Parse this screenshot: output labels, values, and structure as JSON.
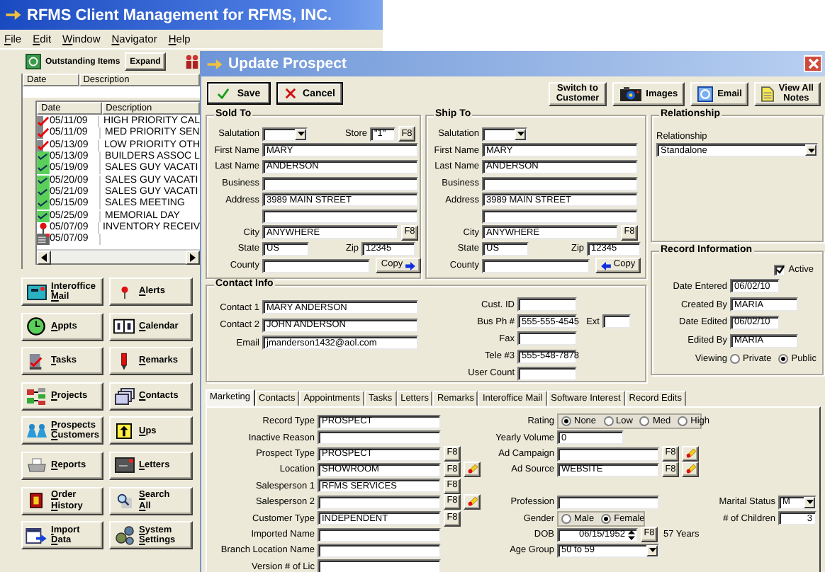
{
  "app": {
    "title": "RFMS Client Management for RFMS, INC.",
    "menu": [
      "File",
      "Edit",
      "Window",
      "Navigator",
      "Help"
    ],
    "toolbar": {
      "label": "Outstanding Items",
      "button": "Expand"
    },
    "outer_list": {
      "columns": [
        "Date",
        "Description"
      ]
    },
    "items": {
      "columns": [
        "Date",
        "Description"
      ],
      "rows": [
        {
          "kind": "task",
          "date": "05/11/09",
          "description": "HIGH PRIORITY CAL"
        },
        {
          "kind": "task",
          "date": "05/11/09",
          "description": "MED PRIORITY SEN"
        },
        {
          "kind": "task",
          "date": "05/13/09",
          "description": "LOW PRIORITY OTH"
        },
        {
          "kind": "appointment",
          "date": "05/13/09",
          "description": "BUILDERS ASSOC L"
        },
        {
          "kind": "appointment",
          "date": "05/19/09",
          "description": "SALES GUY VACATI"
        },
        {
          "kind": "appointment",
          "date": "05/20/09",
          "description": "SALES GUY VACATI"
        },
        {
          "kind": "appointment",
          "date": "05/21/09",
          "description": "SALES GUY VACATI"
        },
        {
          "kind": "appointment",
          "date": "05/15/09",
          "description": "SALES MEETING"
        },
        {
          "kind": "appointment",
          "date": "05/25/09",
          "description": "MEMORIAL DAY"
        },
        {
          "kind": "alert",
          "date": "05/07/09",
          "description": "INVENTORY RECEIV"
        },
        {
          "kind": "memo",
          "date": "05/07/09"
        }
      ]
    },
    "nav_buttons": [
      {
        "kind": "mail",
        "lines": [
          "Interoffice",
          "Mail"
        ]
      },
      {
        "kind": "alert",
        "lines": [
          "Alerts"
        ]
      },
      {
        "kind": "clock",
        "lines": [
          "Appts"
        ]
      },
      {
        "kind": "calendar",
        "lines": [
          "Calendar"
        ]
      },
      {
        "kind": "tasks",
        "lines": [
          "Tasks"
        ]
      },
      {
        "kind": "remarks",
        "lines": [
          "Remarks"
        ]
      },
      {
        "kind": "projects",
        "lines": [
          "Projects"
        ]
      },
      {
        "kind": "contacts",
        "lines": [
          "Contacts"
        ]
      },
      {
        "kind": "people",
        "lines": [
          "Prospects",
          "Customers"
        ]
      },
      {
        "kind": "ups",
        "lines": [
          "Ups"
        ]
      },
      {
        "kind": "reports",
        "lines": [
          "Reports"
        ]
      },
      {
        "kind": "letters",
        "lines": [
          "Letters"
        ]
      },
      {
        "kind": "order",
        "lines": [
          "Order",
          "History"
        ]
      },
      {
        "kind": "search",
        "lines": [
          "Search",
          "All"
        ]
      },
      {
        "kind": "import",
        "lines": [
          "Import",
          "Data"
        ]
      },
      {
        "kind": "settings",
        "lines": [
          "System",
          "Settings"
        ]
      }
    ]
  },
  "dialog": {
    "title": "Update Prospect",
    "actions": [
      {
        "kind": "save",
        "label": "Save"
      },
      {
        "kind": "cancel",
        "label": "Cancel"
      }
    ],
    "links": [
      {
        "kind": "plain",
        "lines": [
          "Switch to",
          "Customer"
        ]
      },
      {
        "kind": "images",
        "lines": [
          "Images"
        ]
      },
      {
        "kind": "email",
        "lines": [
          "Email"
        ]
      },
      {
        "kind": "notes",
        "lines": [
          "View All",
          "Notes"
        ]
      }
    ],
    "sold_to": {
      "title": "Sold To",
      "salutation": "Salutation",
      "store": {
        "label": "Store",
        "value": "\"1\"",
        "button": "F8"
      },
      "first_name": {
        "label": "First Name",
        "value": "MARY"
      },
      "last_name": {
        "label": "Last Name",
        "value": "ANDERSON"
      },
      "business": {
        "label": "Business"
      },
      "address": {
        "label": "Address",
        "value": "3989 MAIN STREET"
      },
      "city": {
        "label": "City",
        "value": "ANYWHERE",
        "button": "F8"
      },
      "state": {
        "label": "State",
        "value": "US"
      },
      "zip": {
        "label": "Zip",
        "value": "12345"
      },
      "county": {
        "label": "County"
      },
      "copy": "Copy"
    },
    "ship_to": {
      "title": "Ship To",
      "salutation": "Salutation",
      "first_name": {
        "label": "First Name",
        "value": "MARY"
      },
      "last_name": {
        "label": "Last Name",
        "value": "ANDERSON"
      },
      "business": {
        "label": "Business"
      },
      "address": {
        "label": "Address",
        "value": "3989 MAIN STREET"
      },
      "city": {
        "label": "City",
        "value": "ANYWHERE",
        "button": "F8"
      },
      "state": {
        "label": "State",
        "value": "US"
      },
      "zip": {
        "label": "Zip",
        "value": "12345"
      },
      "county": {
        "label": "County"
      },
      "copy": "Copy"
    },
    "relationship": {
      "title": "Relationship",
      "label": "Relationship",
      "value": "Standalone"
    },
    "contact_info": {
      "title": "Contact Info",
      "left": [
        {
          "label": "Contact 1",
          "value": "MARY ANDERSON"
        },
        {
          "label": "Contact 2",
          "value": "JOHN ANDERSON"
        },
        {
          "label": "Email",
          "value": "jmanderson1432@aol.com"
        }
      ],
      "right": [
        {
          "label": "Cust. ID"
        },
        {
          "label": "Bus Ph #",
          "value": "555-555-4545",
          "ext_label": "Ext"
        },
        {
          "label": "Fax"
        },
        {
          "label": "Tele #3",
          "value": "555-548-7878"
        },
        {
          "label": "User Count"
        }
      ]
    },
    "record_info": {
      "title": "Record Information",
      "active": {
        "label": "Active",
        "checked": true
      },
      "fields": [
        {
          "label": "Date Entered",
          "value": "06/02/10"
        },
        {
          "label": "Created By",
          "value": "MARIA"
        },
        {
          "label": "Date Edited",
          "value": "06/02/10"
        },
        {
          "label": "Edited By",
          "value": "MARIA"
        }
      ],
      "viewing": {
        "label": "Viewing",
        "options": [
          {
            "label": "Private",
            "selected": false
          },
          {
            "label": "Public",
            "selected": true
          }
        ]
      }
    },
    "tabs": [
      {
        "label": "Marketing",
        "selected": true
      },
      {
        "label": "Contacts",
        "selected": false
      },
      {
        "label": "Appointments",
        "selected": false
      },
      {
        "label": "Tasks",
        "selected": false
      },
      {
        "label": "Letters",
        "selected": false
      },
      {
        "label": "Remarks",
        "selected": false
      },
      {
        "label": "Interoffice Mail",
        "selected": false
      },
      {
        "label": "Software Interest",
        "selected": false
      },
      {
        "label": "Record Edits",
        "selected": false
      }
    ],
    "marketing": {
      "left": [
        {
          "label": "Record Type",
          "value": "PROSPECT"
        },
        {
          "label": "Inactive Reason"
        },
        {
          "label": "Prospect Type",
          "value": "PROSPECT",
          "button": "F8"
        },
        {
          "label": "Location",
          "value": "SHOWROOM",
          "button": "F8",
          "edit": true
        },
        {
          "label": "Salesperson 1",
          "value": "RFMS SERVICES",
          "button": "F8"
        },
        {
          "label": "Salesperson 2",
          "button": "F8",
          "edit": true
        },
        {
          "label": "Customer Type",
          "value": "INDEPENDENT",
          "button": "F8"
        },
        {
          "label": "Imported Name"
        },
        {
          "label": "Branch Location Name"
        },
        {
          "label": "Version # of Lic"
        }
      ],
      "middle": [
        {
          "kind": "radio",
          "label": "Rating",
          "options": [
            {
              "label": "None",
              "selected": true
            },
            {
              "label": "Low",
              "selected": false
            },
            {
              "label": "Med",
              "selected": false
            },
            {
              "label": "High",
              "selected": false
            }
          ]
        },
        {
          "kind": "text",
          "label": "Yearly Volume",
          "value": "0"
        },
        {
          "kind": "text",
          "label": "Ad Campaign",
          "button": "F8",
          "edit": true
        },
        {
          "kind": "text",
          "label": "Ad Source",
          "value": "WEBSITE",
          "button": "F8",
          "edit": true
        },
        {
          "kind": "text",
          "label": "Profession"
        },
        {
          "kind": "radio",
          "label": "Gender",
          "options": [
            {
              "label": "Male",
              "selected": false
            },
            {
              "label": "Female",
              "selected": true
            }
          ]
        },
        {
          "kind": "date",
          "label": "DOB",
          "value": "06/15/1952",
          "button": "F8",
          "note": "57 Years"
        },
        {
          "kind": "select",
          "label": "Age Group",
          "value": "50 to 59"
        }
      ],
      "right": [
        {
          "kind": "select",
          "label": "Marital Status",
          "value": "M"
        },
        {
          "kind": "number",
          "label": "# of Children",
          "value": "3"
        }
      ]
    }
  }
}
